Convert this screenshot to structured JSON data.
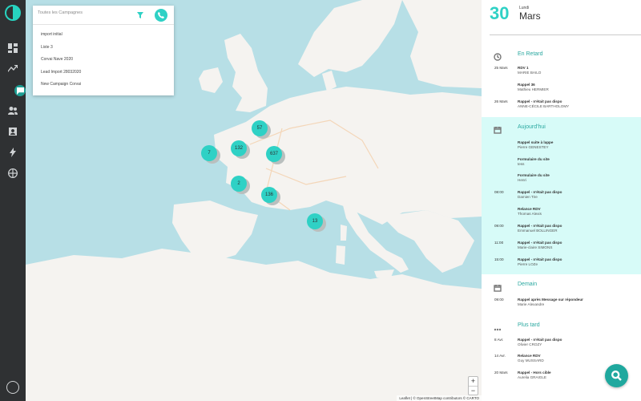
{
  "campaign_panel": {
    "search_placeholder": "Toutes les Campagnes",
    "items": [
      "import initial",
      "Liste 3",
      "Corvai Nave 2020",
      "Lead Import 28032020",
      "New Campaign Corvai"
    ]
  },
  "map": {
    "clusters": [
      "7",
      "57",
      "132",
      "637",
      "2",
      "136",
      "13"
    ],
    "zoom_in": "+",
    "zoom_out": "−",
    "attribution": "Leaflet | © OpenStreetMap contributors © CARTO"
  },
  "agenda": {
    "day": "30",
    "weekday": "Lundi",
    "month": "Mars",
    "sections": [
      {
        "title": "En Retard",
        "icon": "clock-icon",
        "entries": [
          {
            "time": "25 Mars",
            "title": "RDV 1",
            "name": "MARIE BAILO"
          },
          {
            "time": "",
            "title": "Rappel 36",
            "name": "Mathieu HERMIER"
          },
          {
            "time": "26 Mars",
            "title": "Rappel - n'était pas dispo",
            "name": "ANNE-CÉCILE BARTHOLOMY"
          }
        ]
      },
      {
        "title": "Aujourd'hui",
        "icon": "calendar-icon",
        "entries": [
          {
            "time": "",
            "title": "Rappel suite à lappe",
            "name": "Pierre GENESTEY"
          },
          {
            "time": "",
            "title": "Formulaire du site",
            "name": "tess"
          },
          {
            "time": "",
            "title": "Formulaire du site",
            "name": "Henri"
          },
          {
            "time": "08:00",
            "title": "Rappel - n'était pas dispo",
            "name": "Damien Tire"
          },
          {
            "time": "",
            "title": "Relance RDV",
            "name": "Thomas Alexis"
          },
          {
            "time": "09:00",
            "title": "Rappel - n'était pas dispo",
            "name": "Emmanuel BOLLINGER"
          },
          {
            "time": "11:00",
            "title": "Rappel - n'était pas dispo",
            "name": "Marie-claire SIMONS"
          },
          {
            "time": "15:00",
            "title": "Rappel - n'était pas dispo",
            "name": "Pierre LOZe"
          }
        ]
      },
      {
        "title": "Demain",
        "icon": "calendar-icon",
        "entries": [
          {
            "time": "09:00",
            "title": "Rappel après Message sur répondeur",
            "name": "Marie Alexandre"
          }
        ]
      },
      {
        "title": "Plus tard",
        "icon": "ellipsis-icon",
        "entries": [
          {
            "time": "8 Avr.",
            "title": "Rappel - n'était pas dispo",
            "name": "Olivier CROZY"
          },
          {
            "time": "14 Avr.",
            "title": "Relance RDV",
            "name": "Guy MUSSARD"
          },
          {
            "time": "20 Mars",
            "title": "Rappel - Hors cible",
            "name": "Aurelia GRAIGLE"
          }
        ]
      }
    ]
  },
  "colors": {
    "accent": "#2fd1c5",
    "accent_dark": "#1fa89e",
    "sidebar": "#2f3133",
    "highlight": "#d7fbf8"
  }
}
